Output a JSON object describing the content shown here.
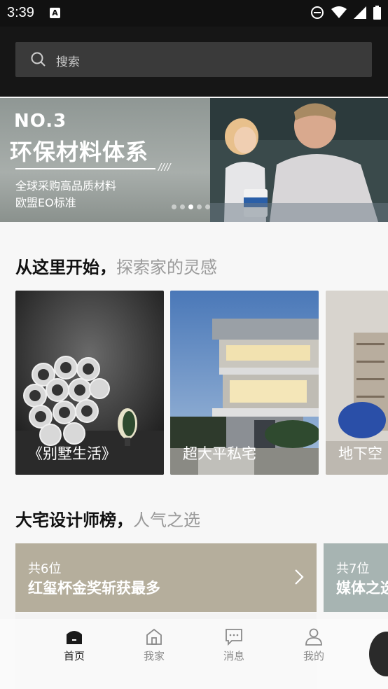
{
  "status_bar": {
    "time": "3:39",
    "app_icon_letter": "A"
  },
  "search": {
    "placeholder": "搜索"
  },
  "banner": {
    "number": "NO.3",
    "title": "环保材料体系",
    "slashes": "////",
    "subtitle_line1": "全球采购高品质材料",
    "subtitle_line2": "欧盟EO标准",
    "dots_total": 5,
    "dots_active_index": 2
  },
  "section_explore": {
    "title_bold": "从这里开始，",
    "title_muted": "探索家的灵感",
    "cards": [
      {
        "label": "《别墅生活》"
      },
      {
        "label": "超大平私宅"
      },
      {
        "label": "地下空"
      }
    ]
  },
  "section_designers": {
    "title_bold": "大宅设计师榜，",
    "title_muted": "人气之选",
    "cards": [
      {
        "count": "共6位",
        "title": "红玺杯金奖斩获最多",
        "color": "#b5ae9c"
      },
      {
        "count": "共7位",
        "title": "媒体之选",
        "color": "#a7b4b2"
      }
    ]
  },
  "bottom_nav": {
    "items": [
      {
        "label": "首页",
        "icon": "home-filled-icon",
        "active": true
      },
      {
        "label": "我家",
        "icon": "house-outline-icon",
        "active": false
      },
      {
        "label": "消息",
        "icon": "message-icon",
        "active": false
      },
      {
        "label": "我的",
        "icon": "user-icon",
        "active": false
      }
    ]
  },
  "colors": {
    "status_bg": "#111111",
    "header_bg": "#161616",
    "search_bg": "#3a3a3a",
    "page_bg": "#f7f7f7"
  }
}
